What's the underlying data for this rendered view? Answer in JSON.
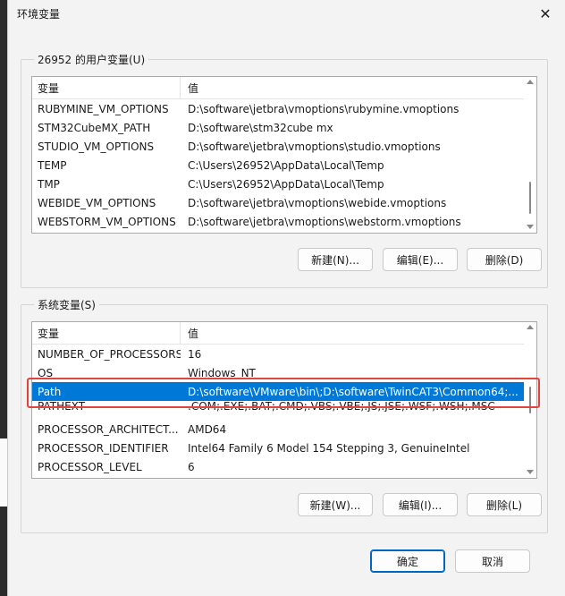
{
  "window": {
    "title": "环境变量",
    "close_glyph": "✕"
  },
  "user_vars": {
    "legend": "26952 的用户变量(U)",
    "header": {
      "name": "变量",
      "value": "值"
    },
    "rows": [
      {
        "name": "RUBYMINE_VM_OPTIONS",
        "value": "D:\\software\\jetbra\\vmoptions\\rubymine.vmoptions"
      },
      {
        "name": "STM32CubeMX_PATH",
        "value": "D:\\software\\stm32cube mx"
      },
      {
        "name": "STUDIO_VM_OPTIONS",
        "value": "D:\\software\\jetbra\\vmoptions\\studio.vmoptions"
      },
      {
        "name": "TEMP",
        "value": "C:\\Users\\26952\\AppData\\Local\\Temp"
      },
      {
        "name": "TMP",
        "value": "C:\\Users\\26952\\AppData\\Local\\Temp"
      },
      {
        "name": "WEBIDE_VM_OPTIONS",
        "value": "D:\\software\\jetbra\\vmoptions\\webide.vmoptions"
      },
      {
        "name": "WEBSTORM_VM_OPTIONS",
        "value": "D:\\software\\jetbra\\vmoptions\\webstorm.vmoptions"
      }
    ],
    "buttons": {
      "new": "新建(N)...",
      "edit": "编辑(E)...",
      "delete": "删除(D)"
    }
  },
  "system_vars": {
    "legend": "系统变量(S)",
    "header": {
      "name": "变量",
      "value": "值"
    },
    "rows": [
      {
        "name": "NUMBER_OF_PROCESSORS",
        "value": "16"
      },
      {
        "name": "OS",
        "value": "Windows_NT"
      },
      {
        "name": "Path",
        "value": "D:\\software\\VMware\\bin\\;D:\\software\\TwinCAT3\\Common64;...",
        "selected": true
      },
      {
        "name": "PATHEXT",
        "value": ".COM;.EXE;.BAT;.CMD;.VBS;.VBE;.JS;.JSE;.WSF;.WSH;.MSC"
      },
      {
        "name": "PROCESSOR_ARCHITECT...",
        "value": "AMD64"
      },
      {
        "name": "PROCESSOR_IDENTIFIER",
        "value": "Intel64 Family 6 Model 154 Stepping 3, GenuineIntel"
      },
      {
        "name": "PROCESSOR_LEVEL",
        "value": "6"
      }
    ],
    "buttons": {
      "new": "新建(W)...",
      "edit": "编辑(I)...",
      "delete": "删除(L)"
    }
  },
  "footer": {
    "ok": "确定",
    "cancel": "取消"
  },
  "colors": {
    "selection": "#0078d7",
    "highlight": "#e0443e",
    "primary_border": "#0067c0"
  }
}
